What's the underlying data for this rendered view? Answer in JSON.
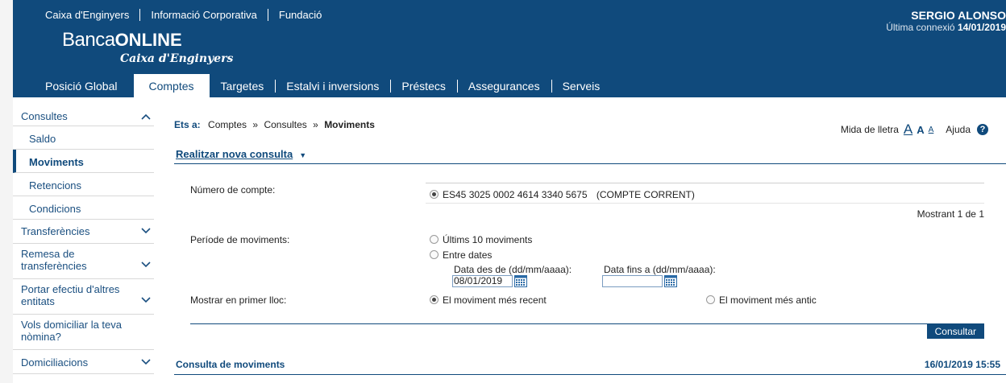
{
  "header": {
    "top_links": [
      "Caixa d'Enginyers",
      "Informació Corporativa",
      "Fundació"
    ],
    "logo": {
      "banca": "Banca",
      "online": "ONLINE",
      "sub": "Caixa d'Enginyers"
    },
    "user": {
      "name": "SERGIO ALONSO",
      "last_conn_label": "Última connexió",
      "last_conn_date": "14/01/2019"
    },
    "nav": [
      "Posició Global",
      "Comptes",
      "Targetes",
      "Estalvi i inversions",
      "Préstecs",
      "Assegurances",
      "Serveis"
    ],
    "nav_active": "Comptes"
  },
  "sidebar": {
    "consultes": "Consultes",
    "sub_items": [
      "Saldo",
      "Moviments",
      "Retencions",
      "Condicions"
    ],
    "active_sub": "Moviments",
    "transferencies": "Transferències",
    "remesa_1": "Remesa de",
    "remesa_2": "transferències",
    "portar_1": "Portar efectiu d'altres",
    "portar_2": "entitats",
    "vols_1": "Vols domiciliar la teva",
    "vols_2": "nòmina?",
    "domiciliacions": "Domiciliacions"
  },
  "breadcrumb": {
    "label": "Ets a:",
    "items": [
      "Comptes",
      "Consultes"
    ],
    "sep": "»",
    "current": "Moviments"
  },
  "tools": {
    "font_size_label": "Mida de lletra",
    "A": "A",
    "help_label": "Ajuda",
    "help_icon": "?"
  },
  "form": {
    "new_query": "Realitzar nova consulta",
    "new_query_arrow": "▼",
    "account_label": "Número de compte:",
    "account_value": "ES45 3025 0002 4614 3340 5675",
    "account_type": "(COMPTE CORRENT)",
    "showing": "Mostrant 1 de 1",
    "period_label": "Període de moviments:",
    "period_last10": "Últims 10 moviments",
    "period_between": "Entre dates",
    "date_from_label": "Data des de (dd/mm/aaaa):",
    "date_from_value": "08/01/2019",
    "date_to_label": "Data fins a (dd/mm/aaaa):",
    "date_to_value": "",
    "order_label": "Mostrar en primer lloc:",
    "order_recent": "El moviment més recent",
    "order_old": "El moviment més antic",
    "submit": "Consultar"
  },
  "results": {
    "title": "Consulta de moviments",
    "timestamp": "16/01/2019 15:55"
  },
  "colors": {
    "brand": "#104a7c"
  }
}
